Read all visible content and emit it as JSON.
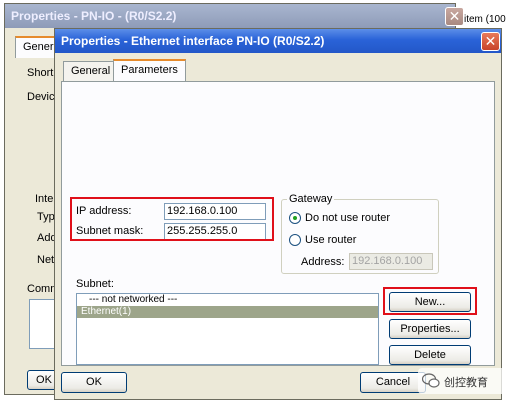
{
  "back_window": {
    "title": "Properties - PN-IO - (R0/S2.2)",
    "partial_right_text": "item (100",
    "tab_general": "General",
    "labels": [
      "Short D",
      "Device",
      "Inter",
      "Typ",
      "Add",
      "Net",
      "Comme"
    ],
    "ok_label": "OK"
  },
  "dialog": {
    "title": "Properties - Ethernet interface  PN-IO (R0/S2.2)",
    "tabs": [
      "General",
      "Parameters"
    ],
    "ip": {
      "label": "IP address:",
      "value": "192.168.0.100"
    },
    "mask": {
      "label": "Subnet mask:",
      "value": "255.255.255.0"
    },
    "gateway": {
      "title": "Gateway",
      "opt_none": "Do not use router",
      "opt_router": "Use router",
      "address_label": "Address:",
      "address_value": "192.168.0.100"
    },
    "subnet": {
      "label": "Subnet:",
      "items": [
        "--- not networked ---",
        "Ethernet(1)"
      ],
      "selected_index": 1
    },
    "buttons": {
      "new": "New...",
      "properties": "Properties...",
      "delete": "Delete",
      "ok": "OK",
      "cancel": "Cancel"
    }
  },
  "watermark": {
    "text": "创控教育"
  },
  "colors": {
    "highlight_box": "#e0101a",
    "title_active": "#2a63d8"
  }
}
